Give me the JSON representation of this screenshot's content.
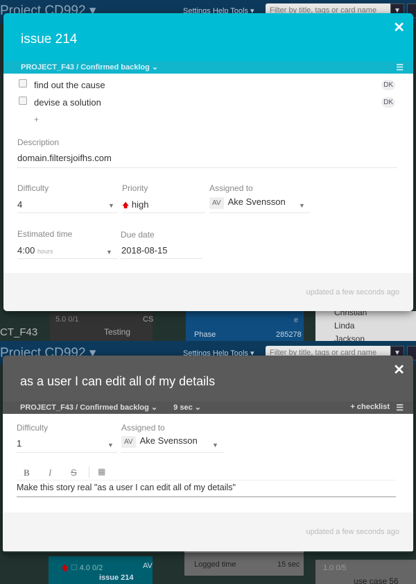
{
  "colors": {
    "accent": "#00bcd4",
    "header_gray": "#5a5a5a",
    "nav": "#0d3a5c",
    "priority_high": "#e00000"
  },
  "app": {
    "project": "Project CD992 ▾",
    "settings": "Settings",
    "help": "Help",
    "tools": "Tools ▾",
    "filter_placeholder": "Filter by title, tags or card name"
  },
  "background_top": {
    "lane": "CT_F43",
    "card_meta": "5.0  0/1",
    "card_user": "CS",
    "card_title": "Testing",
    "blue_e": "e",
    "phase": "Phase",
    "phase_num": "285278",
    "people": [
      "Christian",
      "Linda",
      "Jackson"
    ]
  },
  "background_bottom": {
    "card_meta": "4.0  0/2",
    "card_user": "AV",
    "card_title": "issue 214",
    "logged_label": "Logged time",
    "logged_value": "15 sec",
    "card2_meta": "1.0  0/5",
    "card2_title": "use case 56"
  },
  "modal1": {
    "title": "issue 214",
    "breadcrumb": "PROJECT_F43 / Confirmed backlog ⌄",
    "checklist": [
      {
        "text": "find out the cause",
        "user": "DK",
        "checked": false
      },
      {
        "text": "devise a solution",
        "user": "DK",
        "checked": false
      }
    ],
    "add": "+",
    "description_label": "Description",
    "description": "domain.filtersjoifhs.com",
    "difficulty_label": "Difficulty",
    "difficulty": "4",
    "priority_label": "Priority",
    "priority": "high",
    "assigned_label": "Assigned to",
    "assigned_initials": "AV",
    "assigned": "Ake Svensson",
    "estimate_label": "Estimated time",
    "estimate": "4:00",
    "estimate_unit": "hours",
    "due_label": "Due date",
    "due": "2018-08-15",
    "updated": "updated a few seconds ago"
  },
  "modal2": {
    "title": "as a user I can edit all of my details",
    "breadcrumb": "PROJECT_F43 / Confirmed backlog ⌄",
    "time": "9 sec ⌄",
    "add_checklist": "+ checklist",
    "difficulty_label": "Difficulty",
    "difficulty": "1",
    "assigned_label": "Assigned to",
    "assigned_initials": "AV",
    "assigned": "Ake Svensson",
    "toolbar": {
      "bold": "B",
      "italic": "I",
      "strike": "S",
      "table": "▦"
    },
    "description": "Make this story real \"as a user I can edit all of my details\"",
    "updated": "updated a few seconds ago"
  }
}
